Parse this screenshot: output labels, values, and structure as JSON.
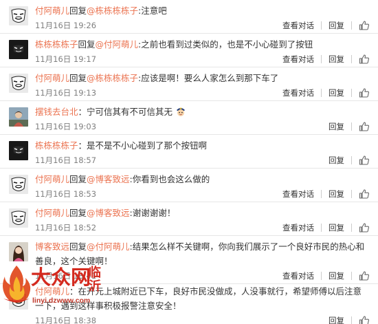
{
  "actions": {
    "view": "查看对话",
    "reply": "回复"
  },
  "comments": [
    {
      "user": "付阿萌儿",
      "prefix": "回复",
      "mention": "@栋栋栋栋子",
      "text": ":注意吧",
      "time": "11月16日 19:26",
      "avatar": "mask",
      "has_view": true
    },
    {
      "user": "栋栋栋栋子",
      "prefix": "回复",
      "mention": "@付阿萌儿",
      "text": ":之前也看到过类似的，也是不小心碰到了按钮",
      "time": "11月16日 19:17",
      "avatar": "dark",
      "has_view": true
    },
    {
      "user": "付阿萌儿",
      "prefix": "回复",
      "mention": "@栋栋栋栋子",
      "text": ":应该是啊！要么人家怎么到那下车了",
      "time": "11月16日 19:13",
      "avatar": "mask",
      "has_view": true
    },
    {
      "user": "摆钱去台北",
      "prefix": "",
      "mention": "",
      "text": "：宁可信其有不可信其无",
      "time": "11月16日 19:03",
      "avatar": "photo",
      "has_view": false,
      "emoji": "police-emoji"
    },
    {
      "user": "栋栋栋栋子",
      "prefix": "",
      "mention": "",
      "text": "：是不是不小心碰到了那个按钮啊",
      "time": "11月16日 18:57",
      "avatar": "dark",
      "has_view": false
    },
    {
      "user": "付阿萌儿",
      "prefix": "回复",
      "mention": "@博客致远",
      "text": ":你看到也会这么做的",
      "time": "11月16日 18:53",
      "avatar": "mask",
      "has_view": true
    },
    {
      "user": "付阿萌儿",
      "prefix": "回复",
      "mention": "@博客致远",
      "text": ":谢谢谢谢！",
      "time": "11月16日 18:52",
      "avatar": "mask",
      "has_view": true
    },
    {
      "user": "博客致远",
      "prefix": "回复",
      "mention": "@付阿萌儿",
      "text": ":结果怎么样不关键啊，你向我们展示了一个良好市民的热心和善良，这个关键啊！",
      "time": "11月16日 18:41",
      "avatar": "woman",
      "has_view": true
    },
    {
      "user": "付阿萌儿",
      "prefix": "",
      "mention": "",
      "text": "：在开元上城附近已下车，良好市民没做成，人没事就行，希望师傅以后注意一下，遇到这样事积极报警注意安全！",
      "time": "11月16日 18:38",
      "avatar": "mask",
      "has_view": false
    }
  ],
  "watermark": {
    "brand": "大众网",
    "city": "临沂",
    "url": "linyi.dzwww.com"
  },
  "colors": {
    "nick": "#eb7350",
    "time": "#808080",
    "divider": "#e6e6e6",
    "watermark": "#d42a1f"
  }
}
